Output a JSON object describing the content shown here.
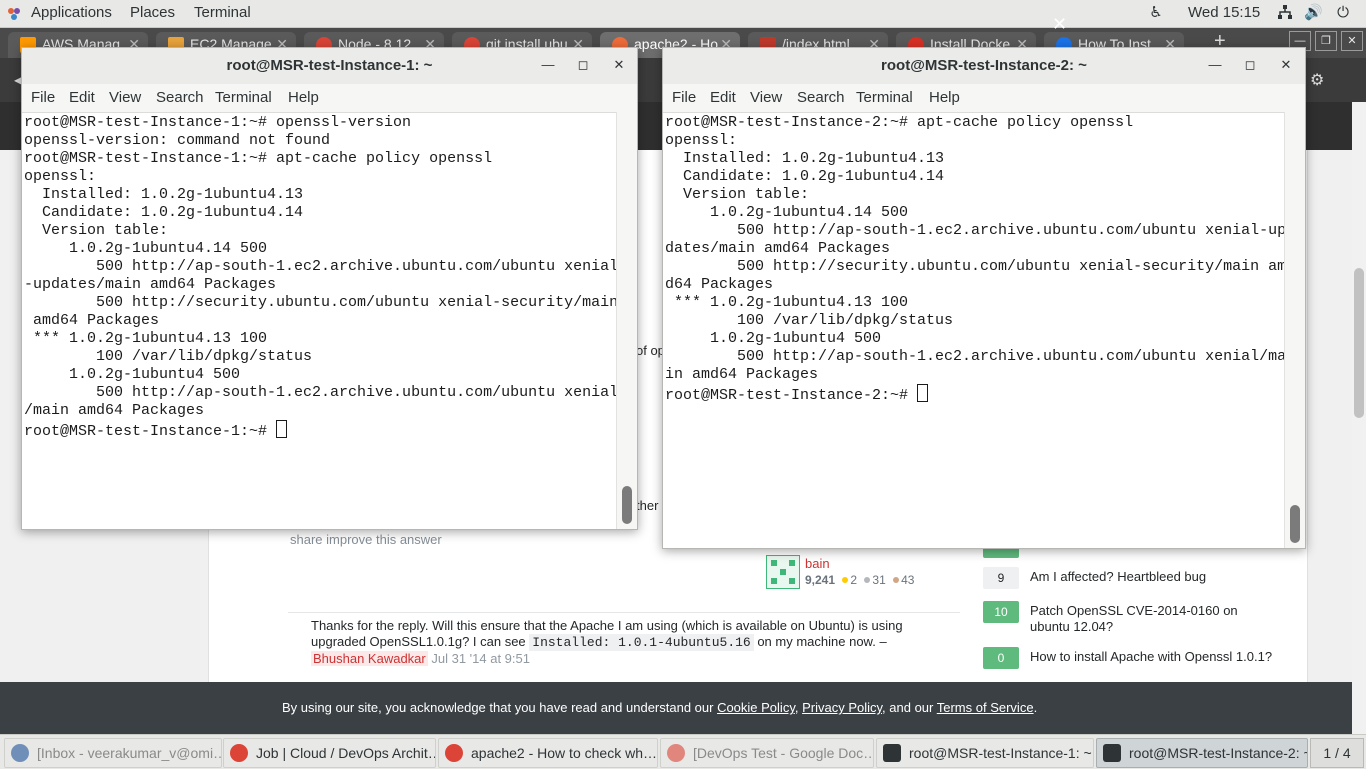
{
  "topbar": {
    "applications": "Applications",
    "places": "Places",
    "terminal": "Terminal",
    "clock": "Wed 15:15",
    "icons": [
      "accessibility-icon",
      "network-icon",
      "volume-icon",
      "power-icon"
    ]
  },
  "chrome": {
    "tabs": [
      {
        "label": "AWS Manag",
        "favicon_color": "#ff9900"
      },
      {
        "label": "EC2 Manage",
        "favicon_color": "#e8a33b"
      },
      {
        "label": "Node - 8.12",
        "favicon_color": "#db4437"
      },
      {
        "label": "git install ubu",
        "favicon_color": "#db4437"
      },
      {
        "label": "apache2 - Ho",
        "favicon_color": "#ef6c3a"
      },
      {
        "label": "/index.html",
        "favicon_color": "#c0392b"
      },
      {
        "label": "Install Docke",
        "favicon_color": "#d93025"
      },
      {
        "label": "How To Inst",
        "favicon_color": "#1a73e8"
      }
    ],
    "new_tab": "+",
    "window_controls": [
      "—",
      "❐",
      "✕"
    ]
  },
  "webpage": {
    "share_links": "share  improve this answer",
    "peek_text_1": "of op",
    "peek_text_2": "ther",
    "answerer": {
      "name": "bain",
      "rep": "9,241",
      "gold": "2",
      "silver": "31",
      "bronze": "43"
    },
    "comment": {
      "text_before": "Thanks for the reply. Will this ensure that the Apache I am using (which is available on Ubuntu) is using upgraded OpenSSL1.0.1g? I can see ",
      "code": "Installed: 1.0.1-4ubuntu5.16",
      "text_after": " on my machine now. –",
      "author": "Bhushan Kawadkar",
      "date": "Jul 31 '14 at 9:51"
    },
    "related": [
      {
        "score": "9",
        "title": "Am I affected? Heartbleed bug",
        "accepted": false
      },
      {
        "score": "10",
        "title": "Patch OpenSSL CVE-2014-0160 on ubuntu 12.04?",
        "accepted": true
      },
      {
        "score": "0",
        "title": "How to install Apache with Openssl 1.0.1?",
        "accepted": true
      }
    ],
    "cookie": {
      "prefix": "By using our site, you acknowledge that you have read and understand our ",
      "cookie_policy": "Cookie Policy",
      "sep1": ", ",
      "privacy_policy": "Privacy Policy",
      "sep2": ", and our ",
      "terms": "Terms of Service",
      "suffix": ".",
      "close": "✕"
    }
  },
  "terminal_menu": [
    "File",
    "Edit",
    "View",
    "Search",
    "Terminal",
    "Help"
  ],
  "term1": {
    "title": "root@MSR-test-Instance-1: ~",
    "lines": [
      "root@MSR-test-Instance-1:~# openssl-version",
      "openssl-version: command not found",
      "root@MSR-test-Instance-1:~# apt-cache policy openssl",
      "openssl:",
      "  Installed: 1.0.2g-1ubuntu4.13",
      "  Candidate: 1.0.2g-1ubuntu4.14",
      "  Version table:",
      "     1.0.2g-1ubuntu4.14 500",
      "        500 http://ap-south-1.ec2.archive.ubuntu.com/ubuntu xenial",
      "-updates/main amd64 Packages",
      "        500 http://security.ubuntu.com/ubuntu xenial-security/main",
      " amd64 Packages",
      " *** 1.0.2g-1ubuntu4.13 100",
      "        100 /var/lib/dpkg/status",
      "     1.0.2g-1ubuntu4 500",
      "        500 http://ap-south-1.ec2.archive.ubuntu.com/ubuntu xenial",
      "/main amd64 Packages"
    ],
    "prompt": "root@MSR-test-Instance-1:~# "
  },
  "term2": {
    "title": "root@MSR-test-Instance-2: ~",
    "lines": [
      "root@MSR-test-Instance-2:~# apt-cache policy openssl",
      "openssl:",
      "  Installed: 1.0.2g-1ubuntu4.13",
      "  Candidate: 1.0.2g-1ubuntu4.14",
      "  Version table:",
      "     1.0.2g-1ubuntu4.14 500",
      "        500 http://ap-south-1.ec2.archive.ubuntu.com/ubuntu xenial-up",
      "dates/main amd64 Packages",
      "        500 http://security.ubuntu.com/ubuntu xenial-security/main am",
      "d64 Packages",
      " *** 1.0.2g-1ubuntu4.13 100",
      "        100 /var/lib/dpkg/status",
      "     1.0.2g-1ubuntu4 500",
      "        500 http://ap-south-1.ec2.archive.ubuntu.com/ubuntu xenial/ma",
      "in amd64 Packages"
    ],
    "prompt": "root@MSR-test-Instance-2:~# "
  },
  "taskbar": {
    "items": [
      {
        "label": "[Inbox - veerakumar_v@omi…",
        "icon_color": "#6f8fb8"
      },
      {
        "label": "Job | Cloud / DevOps Archit…",
        "icon_color": "#db4437"
      },
      {
        "label": "apache2 - How to check wh…",
        "icon_color": "#db4437"
      },
      {
        "label": "[DevOps Test - Google Doc…",
        "icon_color": "#db4437"
      },
      {
        "label": "root@MSR-test-Instance-1: ~",
        "icon_color": "#2e3436"
      },
      {
        "label": "root@MSR-test-Instance-2: ~",
        "icon_color": "#2e3436"
      }
    ],
    "pager": "1 / 4"
  }
}
